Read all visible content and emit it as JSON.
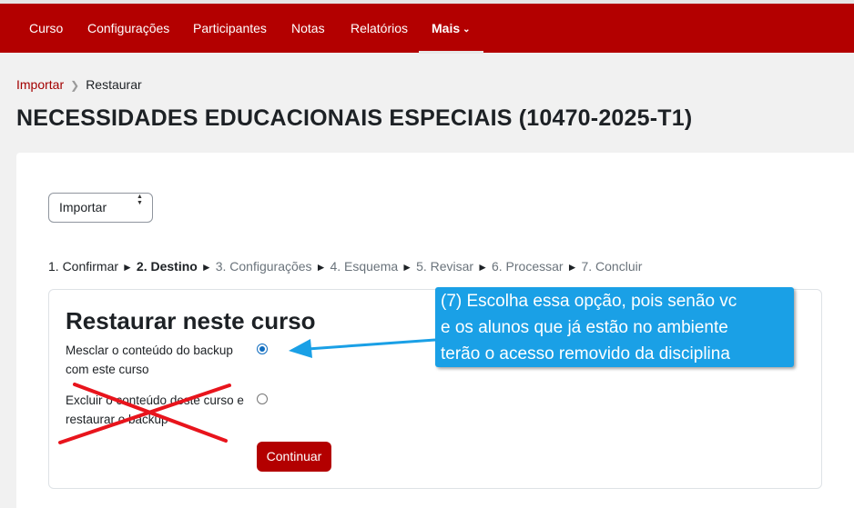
{
  "nav": {
    "items": [
      "Curso",
      "Configurações",
      "Participantes",
      "Notas",
      "Relatórios"
    ],
    "more_label": "Mais"
  },
  "breadcrumb": {
    "parent": "Importar",
    "current": "Restaurar"
  },
  "page_title": "NECESSIDADES EDUCACIONAIS ESPECIAIS (10470-2025-T1)",
  "action_select": {
    "value": "Importar"
  },
  "steps": {
    "s1": "1. Confirmar",
    "s2": "2. Destino",
    "s3": "3. Configurações",
    "s4": "4. Esquema",
    "s5": "5. Revisar",
    "s6": "6. Processar",
    "s7": "7. Concluir",
    "separator": "►"
  },
  "restore": {
    "heading": "Restaurar neste curso",
    "option_merge": "Mesclar o conteúdo do backup com este curso",
    "option_delete": "Excluir o conteúdo deste curso e restaurar o backup",
    "merge_selected": true,
    "continue_label": "Continuar"
  },
  "annotation": {
    "lines": [
      "(7) Escolha essa opção, pois senão vc",
      "e os alunos que já estão no ambiente",
      "terão o acesso removido da disciplina"
    ]
  },
  "colors": {
    "brand": "#b30000",
    "callout": "#1aa0e6",
    "arrow": "#1aa0e6",
    "cross": "#e8141c",
    "radio_checked": "#0f6cbf"
  }
}
